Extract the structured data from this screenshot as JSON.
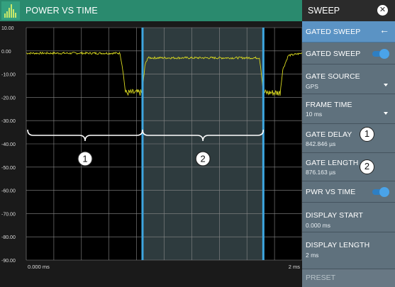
{
  "chart": {
    "title": "POWER VS TIME",
    "x_start": "0.000 ms",
    "x_end": "2 ms"
  },
  "panel": {
    "title": "SWEEP",
    "items": [
      {
        "label": "GATED SWEEP",
        "value": "",
        "kind": "back"
      },
      {
        "label": "GATED SWEEP",
        "value": "",
        "kind": "toggle",
        "on": true
      },
      {
        "label": "GATE SOURCE",
        "value": "GPS",
        "kind": "dropdown"
      },
      {
        "label": "FRAME TIME",
        "value": "10 ms",
        "kind": "dropdown"
      },
      {
        "label": "GATE DELAY",
        "value": "842.846 µs",
        "kind": "value"
      },
      {
        "label": "GATE LENGTH",
        "value": "876.163 µs",
        "kind": "value"
      },
      {
        "label": "PWR VS TIME",
        "value": "",
        "kind": "toggle",
        "on": true
      },
      {
        "label": "DISPLAY START",
        "value": "0.000 ms",
        "kind": "value"
      },
      {
        "label": "DISPLAY LENGTH",
        "value": "2 ms",
        "kind": "value"
      }
    ],
    "partial_item": "PRESET"
  },
  "callouts": [
    "1",
    "2",
    "1",
    "2"
  ],
  "colors": {
    "header": "#2a8a6e",
    "plot_bg": "#000000",
    "gated_region": "#2e3b3e",
    "gate_line": "#3ea6e0",
    "trace": "#d8d820",
    "active_menu": "#5b93c4"
  },
  "chart_data": {
    "type": "line",
    "title": "POWER VS TIME",
    "x_unit": "ms",
    "xlim": [
      0,
      2
    ],
    "ylim": [
      -90,
      10
    ],
    "y_ticks": [
      "10.00",
      "0.00",
      "-10.00",
      "-20.00",
      "-30.00",
      "-40.00",
      "-50.00",
      "-60.00",
      "-70.00",
      "-80.00",
      "-90.00"
    ],
    "x_tick_labels": [
      "0.000 ms",
      "2 ms"
    ],
    "gate_start_ms": 0.843,
    "gate_end_ms": 1.719,
    "series": [
      {
        "x": [
          0,
          0.2,
          0.4,
          0.6,
          0.68,
          0.7,
          0.72,
          0.78,
          0.8,
          0.83,
          0.843,
          0.86,
          0.88,
          1.1,
          1.4,
          1.69,
          1.7,
          1.72,
          1.78,
          1.84,
          1.86,
          1.9,
          2.0
        ],
        "y": [
          -1,
          -1,
          -1,
          -1,
          -1,
          -8,
          -18,
          -18,
          -18,
          -18,
          -18,
          -6.5,
          -3,
          -3,
          -3,
          -3,
          -7,
          -18,
          -18,
          -18,
          -8,
          -2,
          -1
        ]
      }
    ]
  }
}
